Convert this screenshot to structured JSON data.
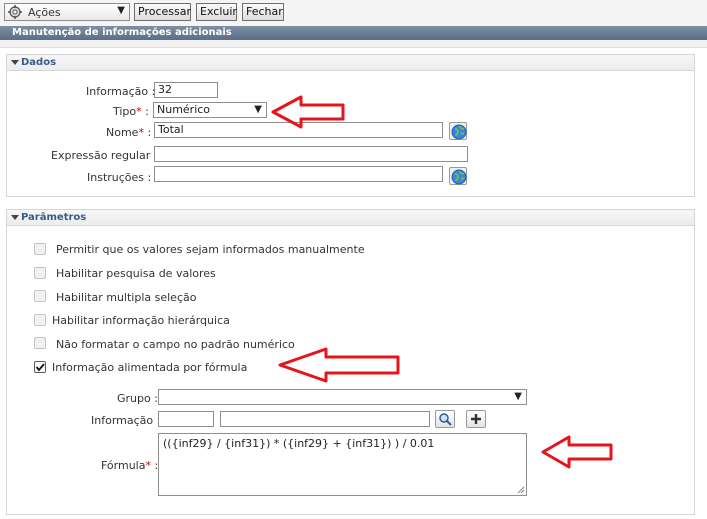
{
  "toolbar": {
    "actions_label": "Ações",
    "process_label": "Processar",
    "delete_label": "Excluir",
    "close_label": "Fechar"
  },
  "window": {
    "title": "Manutenção de informações adicionais"
  },
  "dados": {
    "section_title": "Dados",
    "informacao_label": "Informação :",
    "informacao_value": "32",
    "tipo_label": "Tipo",
    "tipo_value": "Numérico",
    "nome_label": "Nome",
    "nome_value": "Total",
    "expressao_label": "Expressão regular :",
    "expressao_value": "",
    "instrucoes_label": "Instruções :",
    "instrucoes_value": ""
  },
  "parametros": {
    "section_title": "Parâmetros",
    "options": [
      {
        "label": "Permitir que os valores sejam informados manualmente",
        "checked": false
      },
      {
        "label": "Habilitar pesquisa de valores",
        "checked": false
      },
      {
        "label": "Habilitar multipla seleção",
        "checked": false
      },
      {
        "label": "Habilitar informação hierárquica",
        "checked": false
      },
      {
        "label": "Não formatar o campo no padrão numérico",
        "checked": false
      },
      {
        "label": "Informação alimentada por fórmula",
        "checked": true
      }
    ],
    "grupo_label": "Grupo :",
    "grupo_value": "",
    "informacao_label": "Informação :",
    "informacao_code": "",
    "informacao_desc": "",
    "formula_label": "Fórmula",
    "formula_value": "(({inf29} / {inf31}) * ({inf29} + {inf31}) ) / 0.01"
  },
  "colors": {
    "titlebar": "#5b6e84",
    "section_title": "#3a5a8c",
    "required": "#d00000",
    "annotation_arrow": "#e8141c"
  },
  "icons": [
    "gear-icon",
    "chevron-down-icon",
    "globe-icon",
    "search-icon",
    "plus-icon",
    "checkbox-checked-icon",
    "annotation-arrow-icon"
  ]
}
